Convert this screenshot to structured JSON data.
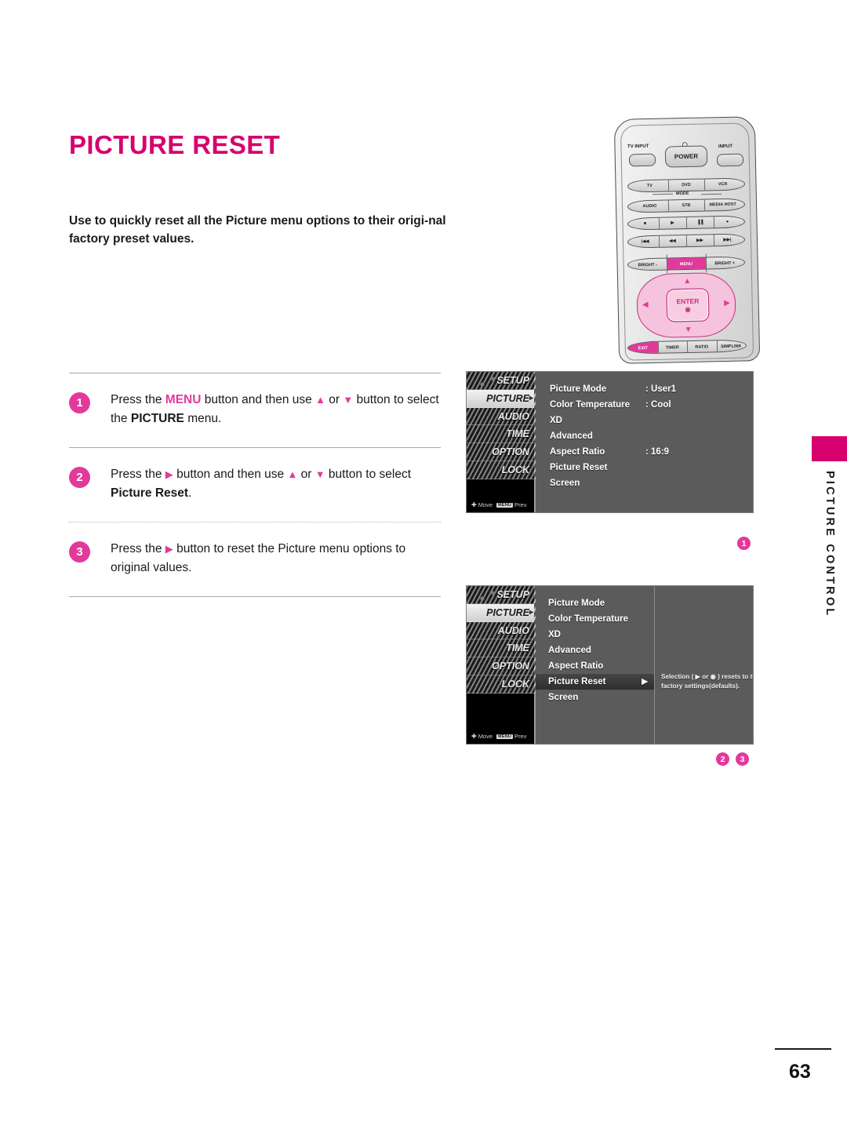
{
  "document": {
    "title": "PICTURE RESET",
    "intro": "Use to quickly reset all the Picture menu options to their origi-nal factory preset values.",
    "side_tab_label": "PICTURE CONTROL",
    "page_number": "63"
  },
  "steps": [
    {
      "number": "1",
      "parts": {
        "p1": "Press the ",
        "kw1": "MENU",
        "p2": " button and then use ",
        "up": "▲",
        "p3": " or ",
        "down": "▼",
        "p4": " button to select the ",
        "kw2": "PICTURE",
        "p5": " menu."
      }
    },
    {
      "number": "2",
      "parts": {
        "p1": "Press the ",
        "right": "▶",
        "p2": " button and then use ",
        "up": "▲",
        "p3": " or ",
        "down": "▼",
        "p4": " button to select ",
        "kw2": "Picture Reset",
        "p5": "."
      }
    },
    {
      "number": "3",
      "parts": {
        "p1": "Press the ",
        "right": "▶",
        "p2": " button to reset the Picture menu options to original values."
      }
    }
  ],
  "osd_nav": [
    "SETUP",
    "PICTURE",
    "AUDIO",
    "TIME",
    "OPTION",
    "LOCK"
  ],
  "osd_footer": {
    "move": "Move",
    "menu_key": "MENU",
    "prev": "Prev"
  },
  "osd1": {
    "rows": [
      {
        "label": "Picture Mode",
        "value": ": User1"
      },
      {
        "label": "Color Temperature",
        "value": ": Cool"
      },
      {
        "label": "XD",
        "value": ""
      },
      {
        "label": "Advanced",
        "value": ""
      },
      {
        "label": "Aspect Ratio",
        "value": ": 16:9"
      },
      {
        "label": "Picture Reset",
        "value": ""
      },
      {
        "label": "Screen",
        "value": ""
      }
    ],
    "marker": "1"
  },
  "osd2": {
    "rows": [
      {
        "label": "Picture Mode",
        "selected": false
      },
      {
        "label": "Color Temperature",
        "selected": false
      },
      {
        "label": "XD",
        "selected": false
      },
      {
        "label": "Advanced",
        "selected": false
      },
      {
        "label": "Aspect Ratio",
        "selected": false
      },
      {
        "label": "Picture Reset",
        "selected": true
      },
      {
        "label": "Screen",
        "selected": false
      }
    ],
    "help_text": "Selection ( ▶ or ◉ ) resets to the factory settings(defaults).",
    "markers": [
      "2",
      "3"
    ]
  },
  "remote": {
    "tv_input": "TV INPUT",
    "power": "POWER",
    "input": "INPUT",
    "mode_label": "MODE",
    "mode_row1": [
      "TV",
      "DVD",
      "VCR"
    ],
    "mode_row2": [
      "AUDIO",
      "STB",
      "MEDIA HOST"
    ],
    "transport_row1": [
      "■",
      "▶",
      "▐▐",
      "●"
    ],
    "transport_row2": [
      "|◀◀",
      "◀◀",
      "▶▶",
      "▶▶|"
    ],
    "menu_row": [
      "BRIGHT -",
      "MENU",
      "BRIGHT +"
    ],
    "enter": "ENTER",
    "dpad": {
      "up": "▲",
      "down": "▼",
      "left": "◀",
      "right": "▶"
    },
    "bottom_row": [
      "EXIT",
      "TIMER",
      "RATIO",
      "SIMPLINK"
    ]
  },
  "colors": {
    "magenta": "#D6006E",
    "pink": "#E2399B",
    "osd_bg": "#5b5b5b",
    "text": "#1a1a1a"
  }
}
